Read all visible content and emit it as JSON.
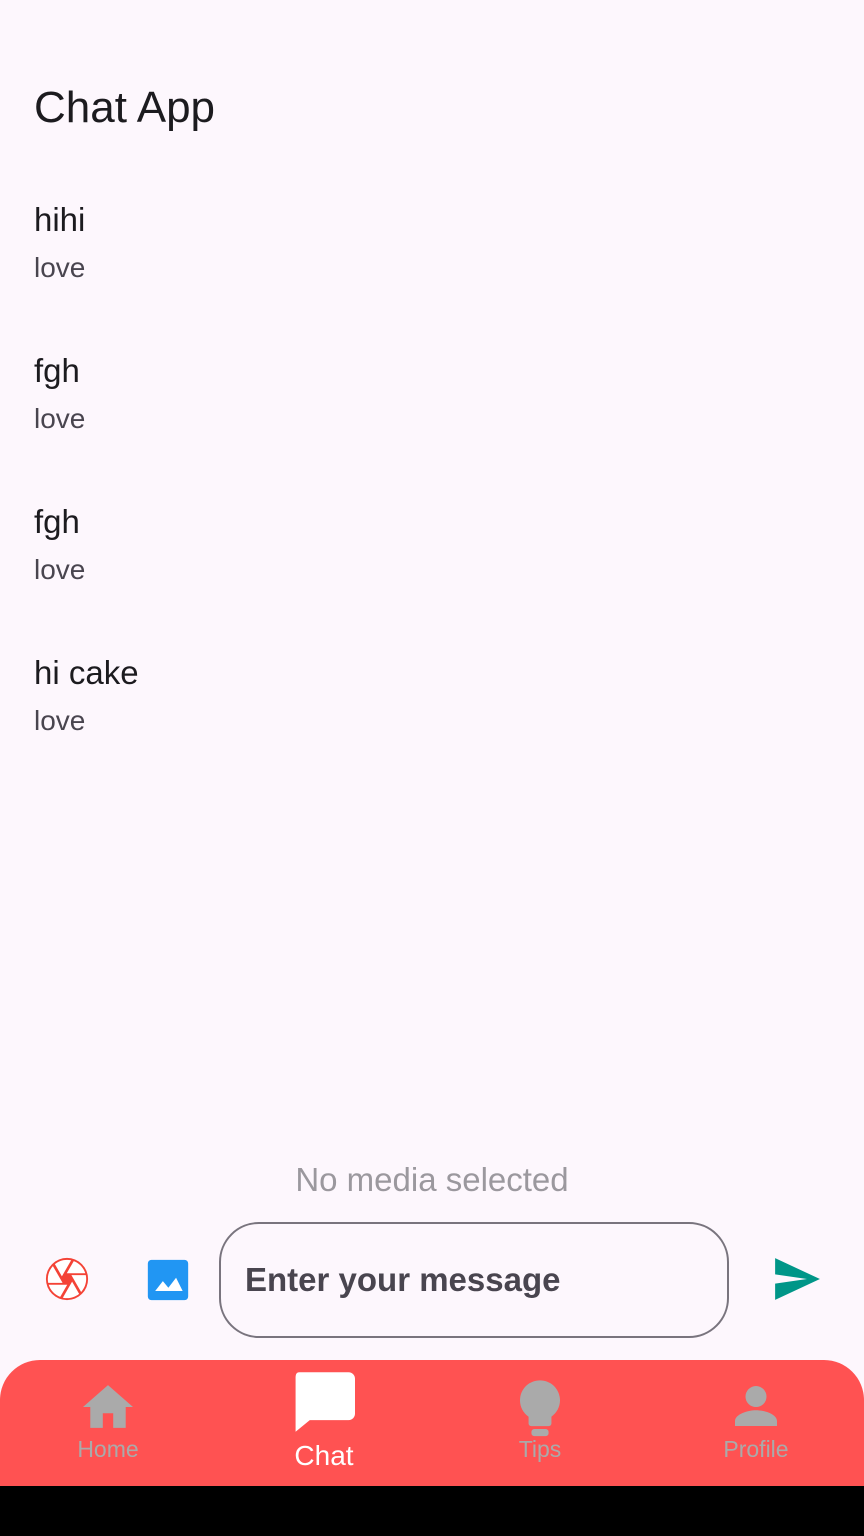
{
  "app": {
    "title": "Chat App"
  },
  "chats": [
    {
      "title": "hihi",
      "subtitle": "love"
    },
    {
      "title": "fgh",
      "subtitle": "love"
    },
    {
      "title": "fgh",
      "subtitle": "love"
    },
    {
      "title": "hi cake",
      "subtitle": "love"
    }
  ],
  "media": {
    "status": "No media selected"
  },
  "composer": {
    "placeholder": "Enter your message",
    "value": "",
    "camera_icon": "camera-shutter-icon",
    "gallery_icon": "image-icon",
    "send_icon": "send-icon"
  },
  "nav": {
    "items": [
      {
        "label": "Home",
        "icon": "home-icon",
        "active": false
      },
      {
        "label": "Chat",
        "icon": "chat-bubble-icon",
        "active": true
      },
      {
        "label": "Tips",
        "icon": "lightbulb-icon",
        "active": false
      },
      {
        "label": "Profile",
        "icon": "person-icon",
        "active": false
      }
    ]
  },
  "colors": {
    "background": "#fdf7fd",
    "nav_background": "#ff5252",
    "nav_active": "#ffffff",
    "nav_inactive": "#aaaaaa",
    "camera": "#f44336",
    "gallery": "#2196f3",
    "send": "#009688"
  }
}
